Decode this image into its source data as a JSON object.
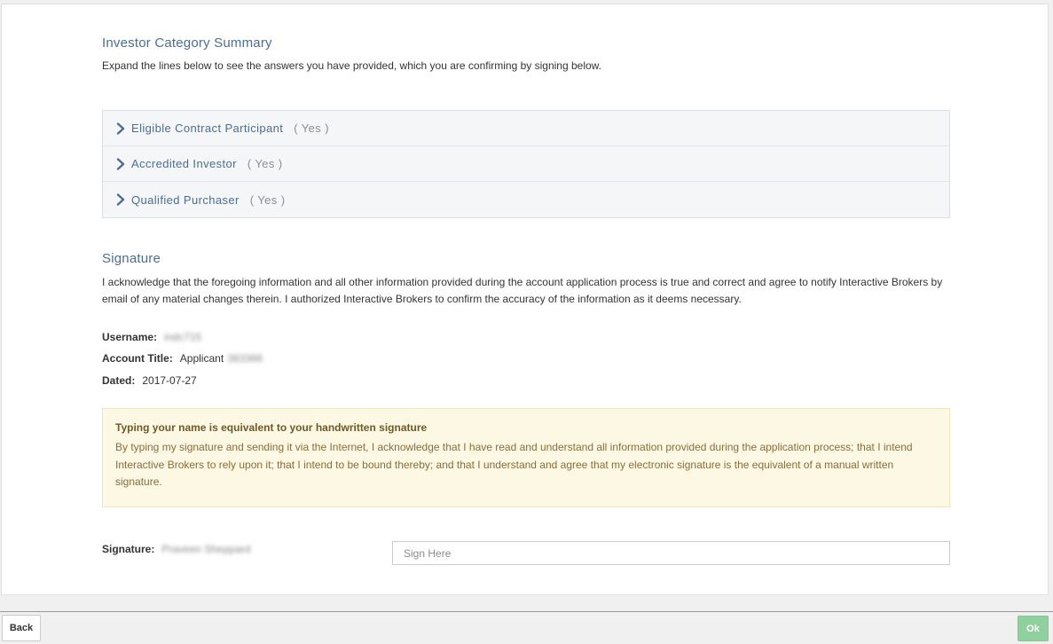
{
  "summary": {
    "title": "Investor Category Summary",
    "intro": "Expand the lines below to see the answers you have provided, which you are confirming by signing below.",
    "items": [
      {
        "label": "Eligible Contract Participant",
        "answer": "( Yes )"
      },
      {
        "label": "Accredited Investor",
        "answer": "( Yes )"
      },
      {
        "label": "Qualified Purchaser",
        "answer": "( Yes )"
      }
    ]
  },
  "signature_section": {
    "title": "Signature",
    "acknowledgement": "I acknowledge that the foregoing information and all other information provided during the account application process is true and correct and agree to notify Interactive Brokers by email of any material changes therein. I authorized Interactive Brokers to confirm the accuracy of the information as it deems necessary.",
    "username_label": "Username:",
    "username_value": "indc715",
    "account_title_label": "Account Title:",
    "account_title_value": "Applicant",
    "account_title_id": "383366",
    "dated_label": "Dated:",
    "dated_value": "2017-07-27"
  },
  "notice": {
    "title": "Typing your name is equivalent to your handwritten signature",
    "text": "By typing my signature and sending it via the Internet, I acknowledge that I have read and understand all information provided during the application process; that I intend Interactive Brokers to rely upon it; that I intend to be bound thereby; and that I understand and agree that my electronic signature is the equivalent of a manual written signature."
  },
  "sign": {
    "label": "Signature:",
    "name": "Praveen Sheppard",
    "placeholder": "Sign Here"
  },
  "footer": {
    "back_label": "Back",
    "ok_label": "Ok"
  },
  "colors": {
    "title": "#4a6e95",
    "notice_bg": "#fcf8e3",
    "ok_button": "#8fd19e"
  },
  "icons": {
    "accordion": "chevron-right-icon"
  }
}
